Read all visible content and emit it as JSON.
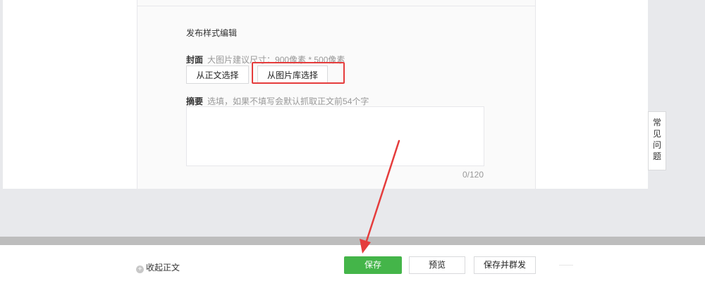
{
  "editor": {
    "section_title": "发布样式编辑",
    "cover": {
      "label": "封面",
      "hint": "大图片建议尺寸：900像素 * 500像素",
      "btn_from_article": "从正文选择",
      "btn_from_library": "从图片库选择"
    },
    "summary": {
      "label": "摘要",
      "hint": "选填，如果不填写会默认抓取正文前54个字",
      "value": "",
      "char_count": "0/120"
    }
  },
  "faq_tab": {
    "chars": [
      "常",
      "见",
      "问",
      "题"
    ]
  },
  "bottom_bar": {
    "collapse_label": "收起正文",
    "collapse_icon": "plus-circle-icon",
    "save_label": "保存",
    "preview_label": "预览",
    "save_and_mass_send_label": "保存并群发"
  },
  "colors": {
    "save_green": "#44b549",
    "annotation_red": "#e53c3c",
    "page_bg": "#e8e9ec"
  }
}
